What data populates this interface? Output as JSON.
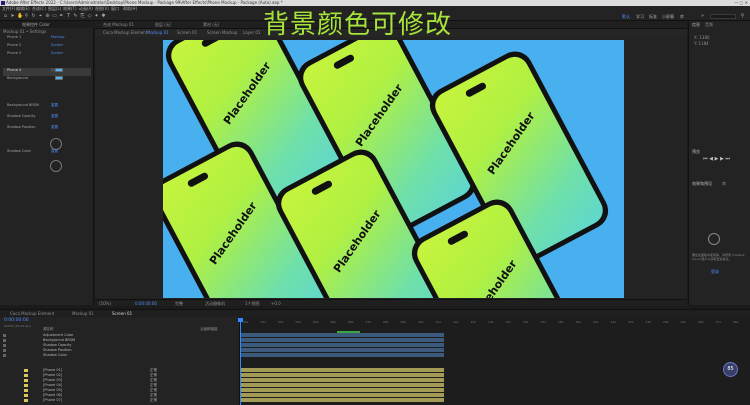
{
  "window": {
    "title": "Adobe After Effects 2022 - C:\\Users\\Administrator\\Desktop\\Phone Mockup - Package 99\\After Effects\\Phone Mockup - Package (Auto).aep *"
  },
  "menu": [
    "文件(F)",
    "编辑(E)",
    "合成(C)",
    "图层(L)",
    "效果(T)",
    "动画(A)",
    "视图(V)",
    "窗口",
    "帮助(H)"
  ],
  "workspaces": [
    "默认",
    "学习",
    "标准",
    "小屏幕",
    "库"
  ],
  "active_workspace": "默认",
  "overlay_title": "背景颜色可修改",
  "left_panel": {
    "tab": "效果控件 Color",
    "comp_label": "Mockup 01 • Settings",
    "effects": [
      {
        "label": "Phone 1",
        "value": "Mockup"
      },
      {
        "label": "Phone 2",
        "value": "Screen"
      },
      {
        "label": "Phone 3",
        "value": "Screen"
      },
      {
        "label": "Phone 4",
        "value": "Color"
      },
      {
        "label": "Background",
        "value": ""
      },
      {
        "label": "Background BRSM",
        "value": "重置"
      },
      {
        "label": "Shadow Opacity",
        "value": "重置"
      },
      {
        "label": "Shadow Position",
        "value": "重置"
      },
      {
        "label": "Shadow Color",
        "value": "重置"
      }
    ]
  },
  "comp": {
    "tabs": [
      "合成 Mockup 01",
      "图层 (无)",
      "素材 (无)"
    ],
    "view_tabs": [
      "Coca Mockup Element",
      "Mockup 01",
      "Screen 01",
      "Screen Mockup",
      "Layer 01"
    ],
    "phone_text": "Placeholder",
    "footer": {
      "zoom": "(50%)",
      "timecode": "0:00:00:00",
      "quality": "完整",
      "camera": "活动摄像机",
      "views": "1个视图",
      "delta": "+0.0"
    }
  },
  "right_panel": {
    "labels": [
      "信息",
      "音频",
      "预览",
      "效果和预设",
      "库",
      "字符",
      "段落",
      "跟踪器",
      "内容识别填充",
      "画笔",
      "对齐"
    ],
    "coords": [
      "X: 1380",
      "Y: 1184"
    ],
    "hint": "要在此面板中使用库，请登录 Creative Cloud 账户以获取更多信息。",
    "sign_in": "登录"
  },
  "timeline": {
    "tabs": [
      "Coca Mockup Element",
      "Mockup 01",
      "Screen 01"
    ],
    "timecode": "0:00:00:00",
    "fps": "00000 (25.00 fps)",
    "columns": [
      "源名称",
      "父级和链接",
      "模式",
      "TrkMat"
    ],
    "layers": [
      {
        "num": "",
        "name": "Adjustment Color",
        "mode": ""
      },
      {
        "num": "",
        "name": "Background BRSM",
        "mode": ""
      },
      {
        "num": "",
        "name": "Shadow Opacity",
        "mode": ""
      },
      {
        "num": "",
        "name": "Shadow Position",
        "mode": ""
      },
      {
        "num": "",
        "name": "Shadow Color",
        "mode": ""
      },
      {
        "num": "1",
        "name": "[Phone 01]",
        "mode": "正常"
      },
      {
        "num": "2",
        "name": "[Phone 02]",
        "mode": "正常"
      },
      {
        "num": "3",
        "name": "[Phone 03]",
        "mode": "正常"
      },
      {
        "num": "4",
        "name": "[Phone 04]",
        "mode": "正常"
      },
      {
        "num": "5",
        "name": "[Phone 05]",
        "mode": "正常"
      },
      {
        "num": "6",
        "name": "[Phone 06]",
        "mode": "正常"
      },
      {
        "num": "7",
        "name": "[Phone 07]",
        "mode": "正常"
      }
    ],
    "ruler": [
      "00s",
      "01s",
      "02s",
      "03s",
      "04s",
      "05s",
      "06s",
      "07s",
      "08s",
      "09s",
      "10s",
      "11s",
      "12s",
      "13s",
      "14s",
      "15s",
      "16s",
      "17s",
      "18s",
      "19s",
      "20s",
      "21s",
      "22s",
      "23s",
      "24s",
      "25s",
      "26s",
      "27s",
      "28s"
    ],
    "speed": "85"
  },
  "colors": {
    "accent": "#4f8ff7",
    "canvas_bg": "#49b0f0",
    "title_green": "#a6e43a",
    "layer_bar": "#a39a55"
  }
}
